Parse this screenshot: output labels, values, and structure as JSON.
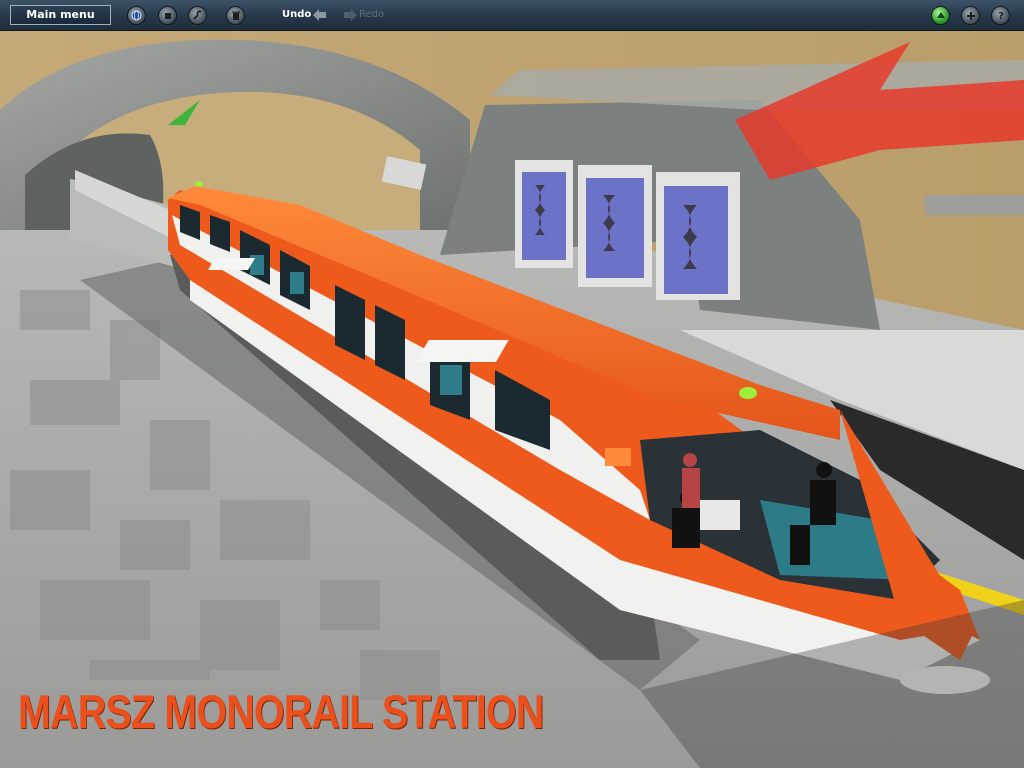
{
  "toolbar": {
    "main_menu_label": "Main menu",
    "undo_label": "Undo",
    "redo_label": "Redo",
    "left_icons": [
      "globe-icon",
      "stop-icon",
      "wrench-icon",
      "trash-icon"
    ],
    "right_icons": [
      "green-light-icon",
      "plus-icon",
      "help-icon"
    ]
  },
  "scene": {
    "caption": "MARSZ MONORAIL STATION",
    "train_color": "#ee5a1c",
    "caption_color": "#ea4f1c"
  }
}
